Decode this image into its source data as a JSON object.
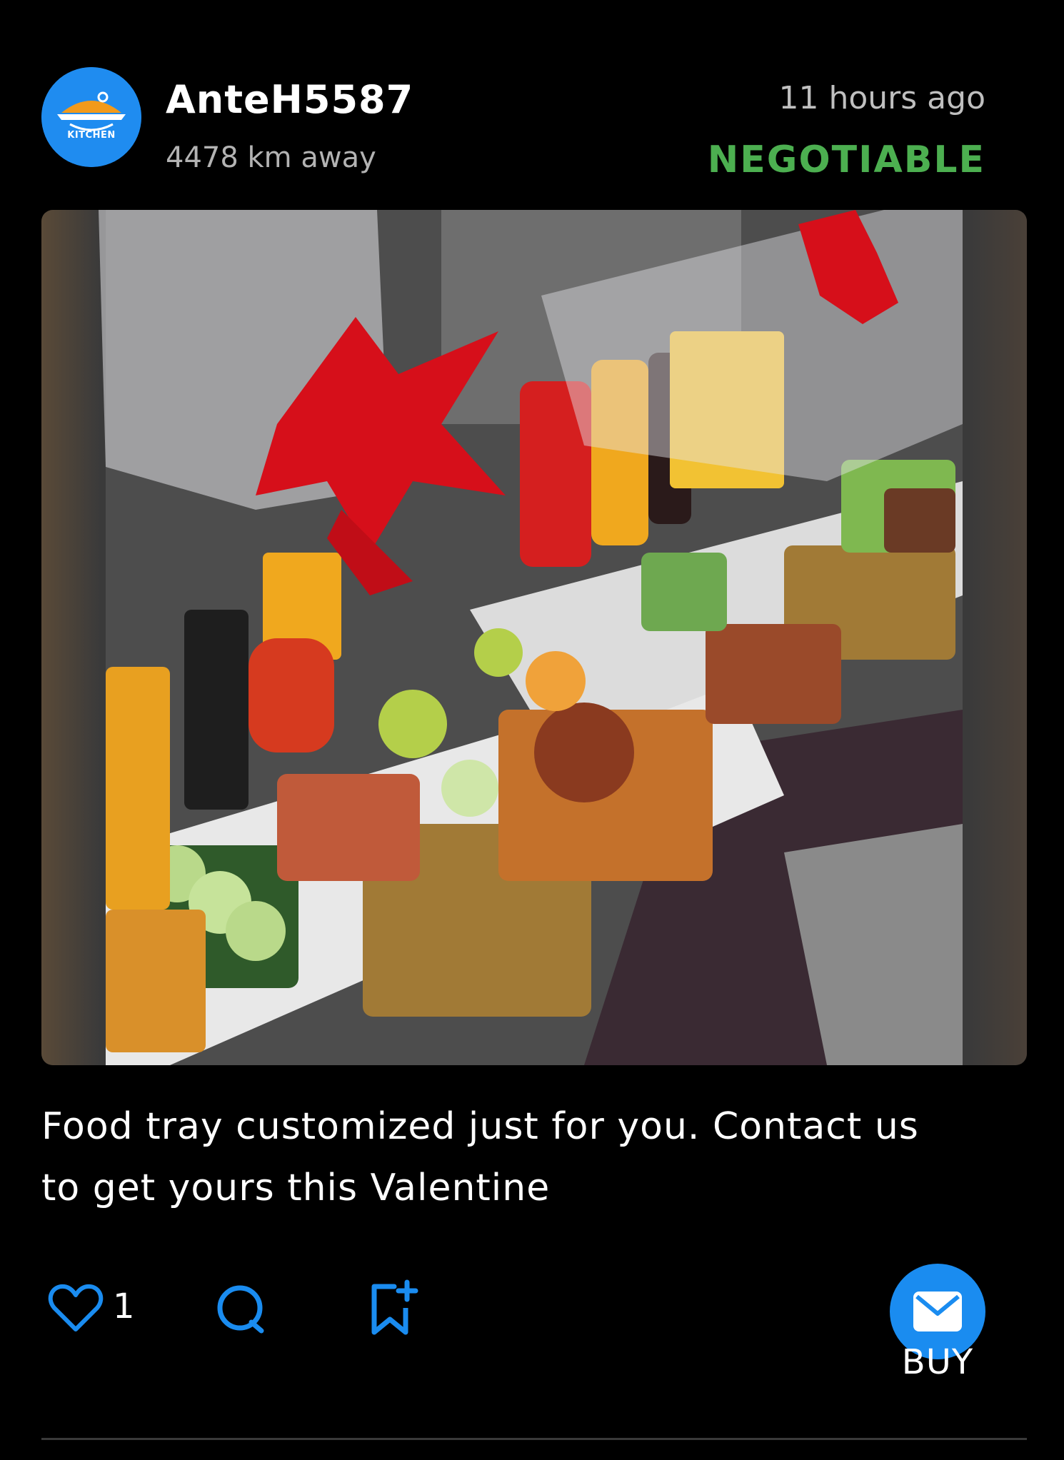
{
  "post": {
    "avatar_label": "KITCHEN",
    "username": "AnteH5587",
    "distance": "4478 km away",
    "time_ago": "11 hours ago",
    "price_status": "NEGOTIABLE",
    "caption_line1": "Food tray customized just for you. Contact us",
    "caption_line2": "to get yours this Valentine"
  },
  "actions": {
    "like_count": "1",
    "buy_label": "BUY"
  },
  "icons": {
    "like": "heart-outline-icon",
    "comment": "comment-bubble-icon",
    "save": "bookmark-plus-icon",
    "buy": "envelope-icon"
  },
  "colors": {
    "background": "#000000",
    "accent_blue": "#1a8cf0",
    "negotiable_green": "#4caf50",
    "muted_text": "#b3b3b3"
  }
}
